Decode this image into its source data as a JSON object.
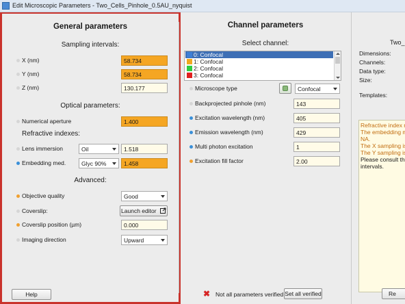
{
  "window": {
    "title": "Edit Microscopic Parameters - Two_Cells_Pinhole_0.5AU_nyquist"
  },
  "left": {
    "heading": "General parameters",
    "sampling": {
      "heading": "Sampling intervals:",
      "x_label": "X (nm)",
      "x_value": "58.734",
      "y_label": "Y (nm)",
      "y_value": "58.734",
      "z_label": "Z (nm)",
      "z_value": "130.177"
    },
    "optical": {
      "heading": "Optical parameters:",
      "na_label": "Numerical aperture",
      "na_value": "1.400",
      "ri_heading": "Refractive indexes:",
      "lens_label": "Lens immersion",
      "lens_medium": "Oil",
      "lens_value": "1.518",
      "embed_label": "Embedding med.",
      "embed_medium": "Glyc 90%",
      "embed_value": "1.458"
    },
    "advanced": {
      "heading": "Advanced:",
      "quality_label": "Objective quality",
      "quality_value": "Good",
      "coverslip_label": "Coverslip:",
      "launch_editor": "Launch editor",
      "coverslip_pos_label": "Coverslip position (µm)",
      "coverslip_pos_value": "0.000",
      "imaging_label": "Imaging direction",
      "imaging_value": "Upward"
    },
    "help_button": "Help"
  },
  "middle": {
    "heading": "Channel parameters",
    "select_label": "Select channel:",
    "channels": [
      {
        "label": "0: Confocal",
        "color": "#3d7fd6"
      },
      {
        "label": "1: Confocal",
        "color": "#f0a820"
      },
      {
        "label": "2: Confocal",
        "color": "#2ecc40"
      },
      {
        "label": "3: Confocal",
        "color": "#e02020"
      }
    ],
    "microscope_label": "Microscope type",
    "microscope_value": "Confocal",
    "pinhole_label": "Backprojected pinhole (nm)",
    "pinhole_value": "143",
    "excitation_label": "Excitation wavelength (nm)",
    "excitation_value": "405",
    "emission_label": "Emission wavelength (nm)",
    "emission_value": "429",
    "multiphoton_label": "Multi photon excitation",
    "multiphoton_value": "1",
    "fill_label": "Excitation fill factor",
    "fill_value": "2.00",
    "status_text": "Not all parameters verified",
    "set_all_button": "Set all verified"
  },
  "right": {
    "title": "Two_",
    "dimensions": "Dimensions:",
    "channels": "Channels:",
    "data_type": "Data type:",
    "size": "Size:",
    "templates": "Templates:",
    "info_lines": [
      {
        "text": "Refractive index m",
        "kind": "warn"
      },
      {
        "text": "The embedding m",
        "kind": "warn"
      },
      {
        "text": "NA.",
        "kind": "warn"
      },
      {
        "text": "The X sampling is",
        "kind": "warn"
      },
      {
        "text": "The Y sampling is",
        "kind": "warn"
      },
      {
        "text": "Please consult the",
        "kind": "normal"
      },
      {
        "text": "intervals.",
        "kind": "normal"
      }
    ],
    "button_partial": "Re"
  }
}
